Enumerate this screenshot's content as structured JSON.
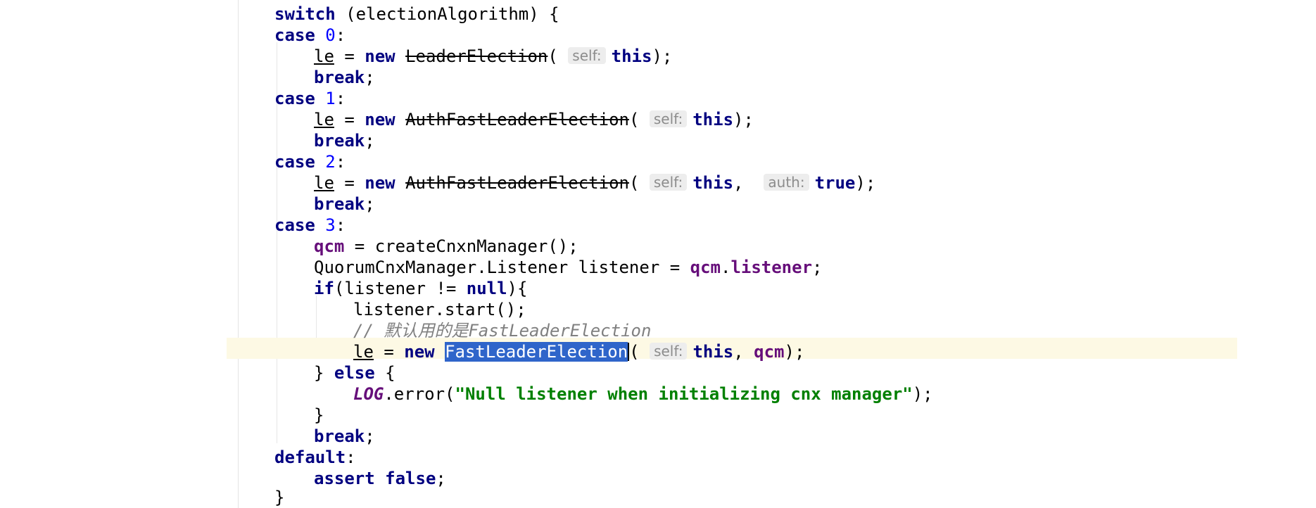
{
  "editor": {
    "lines": {
      "l0": {
        "kw_switch": "switch",
        "rest": " (electionAlgorithm) {"
      },
      "l1": {
        "kw_case": "case",
        "num": "0",
        "colon": ":"
      },
      "l2": {
        "var": "le",
        "eq": " = ",
        "kw_new": "new",
        "cls": "LeaderElection",
        "paren": "(",
        "hint_self": "self:",
        "kw_this": "this",
        "end": ");"
      },
      "l3": {
        "kw_break": "break",
        "semi": ";"
      },
      "l4": {
        "kw_case": "case",
        "num": "1",
        "colon": ":"
      },
      "l5": {
        "var": "le",
        "eq": " = ",
        "kw_new": "new",
        "cls": "AuthFastLeaderElection",
        "paren": "(",
        "hint_self": "self:",
        "kw_this": "this",
        "end": ");"
      },
      "l6": {
        "kw_break": "break",
        "semi": ";"
      },
      "l7": {
        "kw_case": "case",
        "num": "2",
        "colon": ":"
      },
      "l8": {
        "var": "le",
        "eq": " = ",
        "kw_new": "new",
        "cls": "AuthFastLeaderElection",
        "paren": "(",
        "hint_self": "self:",
        "kw_this": "this",
        "comma": ", ",
        "hint_auth": "auth:",
        "kw_true": "true",
        "end": ");"
      },
      "l9": {
        "kw_break": "break",
        "semi": ";"
      },
      "l10": {
        "kw_case": "case",
        "num": "3",
        "colon": ":"
      },
      "l11": {
        "fld": "qcm",
        "rest": " = createCnxnManager();"
      },
      "l12": {
        "pre": "QuorumCnxManager.Listener listener = ",
        "fld_qcm": "qcm",
        "dot": ".",
        "fld_listener": "listener",
        "end": ";"
      },
      "l13": {
        "kw_if": "if",
        "rest": "(listener != ",
        "kw_null": "null",
        "end": "){"
      },
      "l14": {
        "text": "listener.start();"
      },
      "l15": {
        "comment": "// 默认用的是FastLeaderElection"
      },
      "l16": {
        "var": "le",
        "eq": " = ",
        "kw_new": "new",
        "cls": "FastLeaderElection",
        "paren": "(",
        "hint_self": "self:",
        "kw_this": "this",
        "comma": ", ",
        "fld_qcm": "qcm",
        "end": ");"
      },
      "l17": {
        "brace": "} ",
        "kw_else": "else",
        "end": " {"
      },
      "l18": {
        "static": "LOG",
        "call": ".error(",
        "str": "\"Null listener when initializing cnx manager\"",
        "end": ");"
      },
      "l19": {
        "text": "}"
      },
      "l20": {
        "kw_break": "break",
        "semi": ";"
      },
      "l21": {
        "kw_default": "default",
        "colon": ":"
      },
      "l22": {
        "kw_assert": "assert",
        "sp": " ",
        "kw_false": "false",
        "semi": ";"
      },
      "l23": {
        "text": "}"
      }
    }
  },
  "colors": {
    "keyword": "#000080",
    "number": "#0000ff",
    "field": "#660e7a",
    "string": "#008000",
    "comment": "#808080",
    "selection": "#2f65ca",
    "current_line": "#fdf9e4"
  }
}
